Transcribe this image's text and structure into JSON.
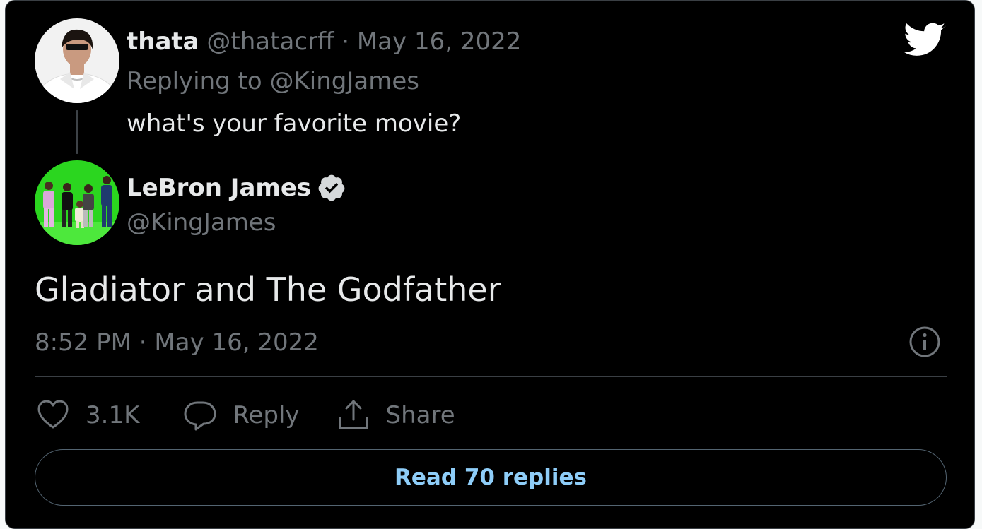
{
  "reply_tweet": {
    "name": "thata",
    "handle": "@thatacrff",
    "separator": "·",
    "date": "May 16, 2022",
    "replying_to": "Replying to @KingJames",
    "text": "what's your favorite movie?"
  },
  "main_tweet": {
    "name": "LeBron James",
    "handle": "@KingJames",
    "text": "Gladiator and The Godfather",
    "timestamp": "8:52 PM · May 16, 2022"
  },
  "actions": {
    "like_count": "3.1K",
    "reply_label": "Reply",
    "share_label": "Share"
  },
  "read_replies_label": "Read 70 replies",
  "icons": {
    "logo": "twitter-bird-icon",
    "verified": "verified-badge-icon",
    "info": "info-icon",
    "like": "heart-icon",
    "reply": "speech-bubble-icon",
    "share": "share-icon"
  },
  "colors": {
    "background": "#000000",
    "text_primary": "#e7e9ea",
    "text_muted": "#71767b",
    "link": "#8ecdf8",
    "border": "#3a3f44"
  }
}
